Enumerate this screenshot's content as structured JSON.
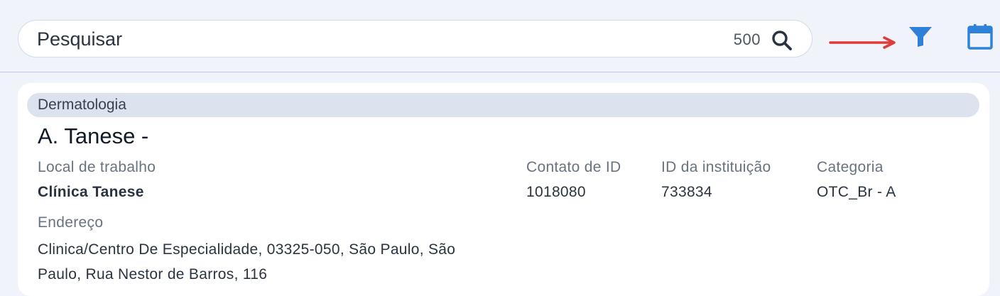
{
  "search": {
    "placeholder": "Pesquisar",
    "result_count": "500"
  },
  "toolbar": {
    "search_icon": "search-icon",
    "filter_icon": "filter-icon",
    "calendar_icon": "calendar-icon",
    "arrow_icon": "arrow-right-icon",
    "accent_color": "#2f80d9",
    "arrow_color": "#e03a3a"
  },
  "card": {
    "specialty": "Dermatologia",
    "name": "A. Tanese -",
    "workplace_label": "Local de trabalho",
    "workplace": "Clínica Tanese",
    "contact_id_label": "Contato de ID",
    "contact_id": "1018080",
    "institution_id_label": "ID da instituição",
    "institution_id": "733834",
    "category_label": "Categoria",
    "category": "OTC_Br - A",
    "address_label": "Endereço",
    "address": "Clinica/Centro De Especialidade, 03325-050, São Paulo, São Paulo, Rua Nestor de Barros, 116"
  }
}
